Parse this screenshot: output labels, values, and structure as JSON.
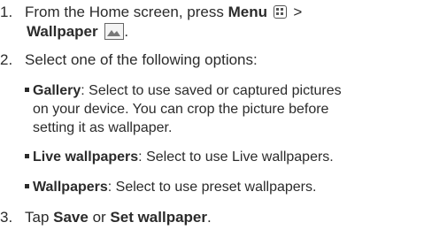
{
  "steps": [
    {
      "number": "1.",
      "line1_pre": "From the Home screen, press ",
      "line1_bold": "Menu",
      "line1_post": " >",
      "line2_bold": "Wallpaper",
      "line2_post": "."
    },
    {
      "number": "2.",
      "text": "Select one of the following options:"
    },
    {
      "number": "3.",
      "pre": "Tap ",
      "bold1": "Save",
      "mid": " or ",
      "bold2": "Set wallpaper",
      "post": "."
    }
  ],
  "options": [
    {
      "name": "Gallery",
      "desc": ": Select to use saved or captured pictures",
      "desc2": "on your device. You can crop the picture before",
      "desc3": "setting it as wallpaper."
    },
    {
      "name": "Live wallpapers",
      "desc": ": Select to use Live wallpapers."
    },
    {
      "name": "Wallpapers",
      "desc": ": Select to use preset wallpapers."
    }
  ],
  "icons": {
    "menu": "menu-key-icon",
    "wallpaper": "wallpaper-icon"
  }
}
